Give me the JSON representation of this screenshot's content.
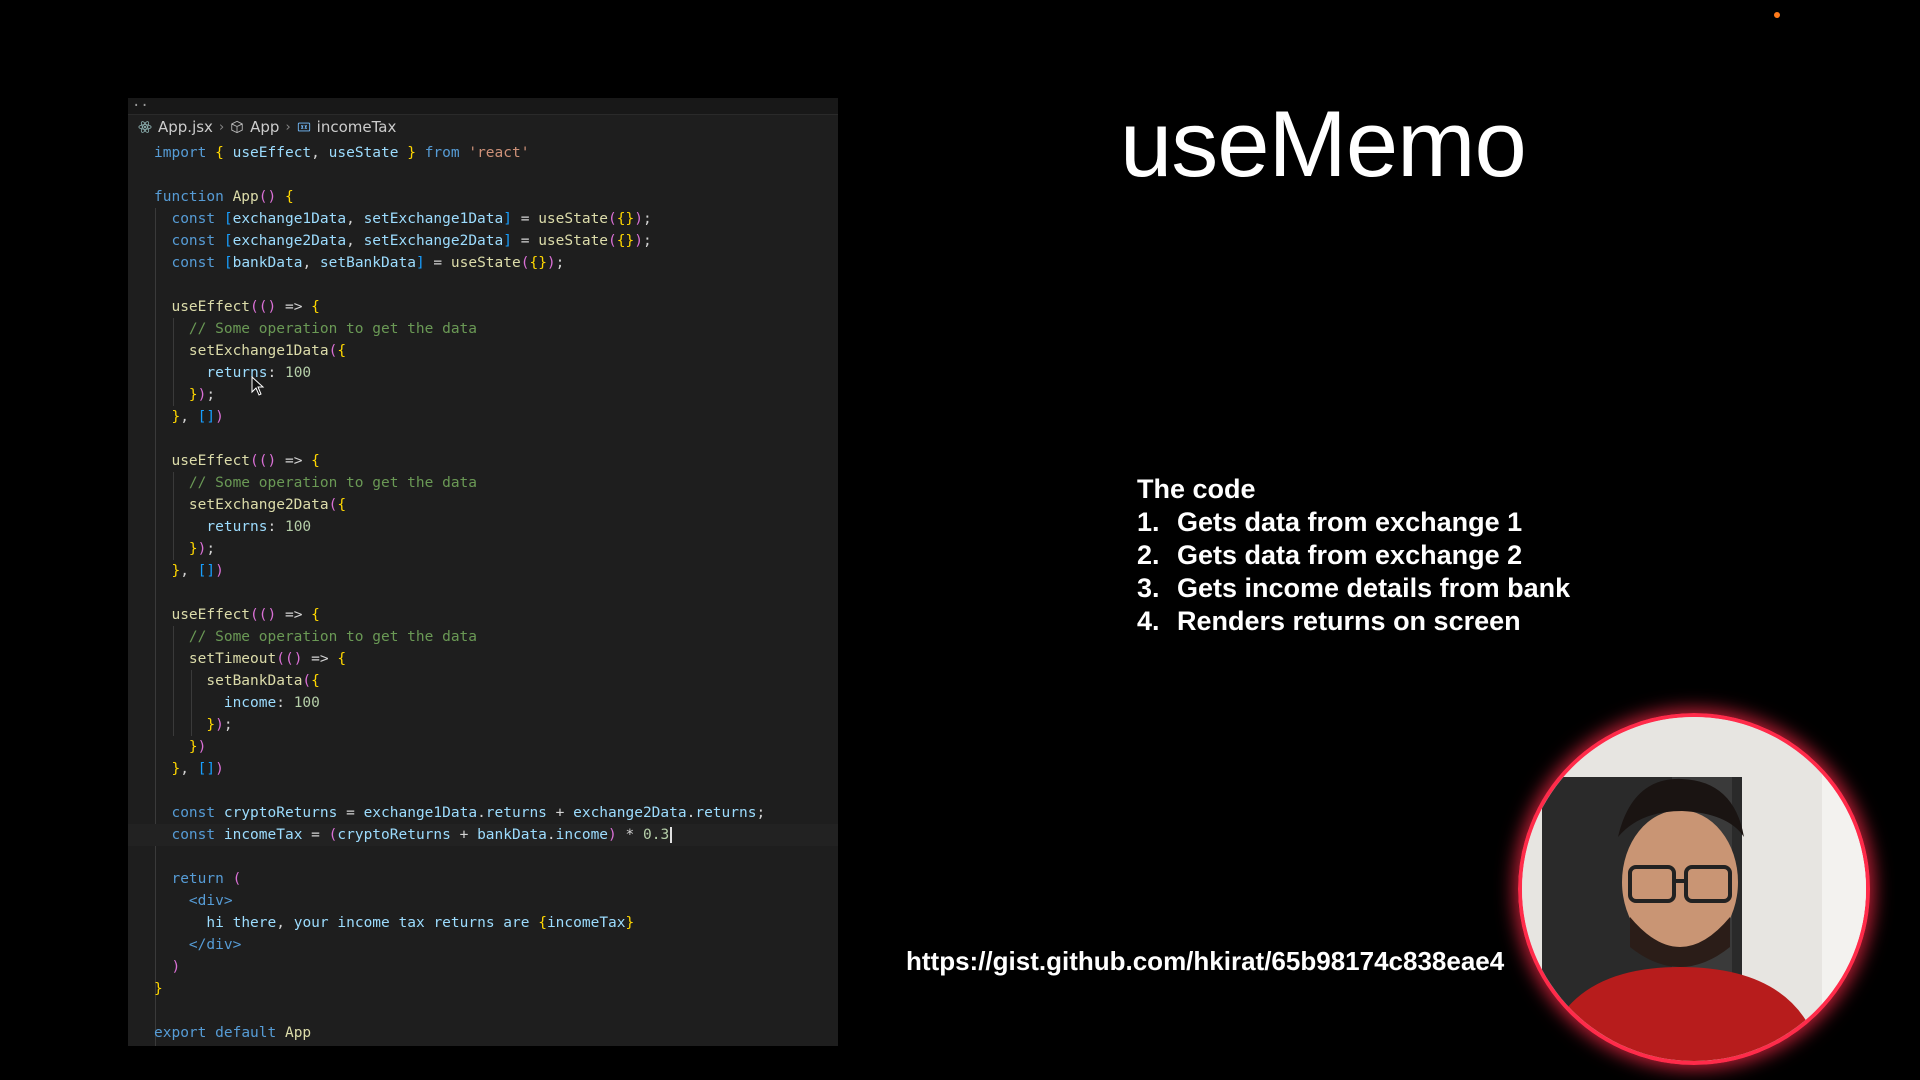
{
  "editor": {
    "tab_overflow": "..",
    "breadcrumb": {
      "file": "App.jsx",
      "component": "App",
      "symbol": "incomeTax"
    },
    "code_lines": [
      "import { useEffect, useState } from 'react'",
      "",
      "function App() {",
      "  const [exchange1Data, setExchange1Data] = useState({});",
      "  const [exchange2Data, setExchange2Data] = useState({});",
      "  const [bankData, setBankData] = useState({});",
      "",
      "  useEffect(() => {",
      "    // Some operation to get the data",
      "    setExchange1Data({",
      "      returns: 100",
      "    });",
      "  }, [])",
      "",
      "  useEffect(() => {",
      "    // Some operation to get the data",
      "    setExchange2Data({",
      "      returns: 100",
      "    });",
      "  }, [])",
      "",
      "  useEffect(() => {",
      "    // Some operation to get the data",
      "    setTimeout(() => {",
      "      setBankData({",
      "        income: 100",
      "      });",
      "    })",
      "  }, [])",
      "",
      "  const cryptoReturns = exchange1Data.returns + exchange2Data.returns;",
      "  const incomeTax = (cryptoReturns + bankData.income) * 0.3",
      "",
      "  return (",
      "    <div>",
      "      hi there, your income tax returns are {incomeTax}",
      "    </div>",
      "  )",
      "}",
      "",
      "export default App"
    ]
  },
  "slide": {
    "title": "useMemo",
    "description_heading": "The code",
    "steps": [
      {
        "num": "1.",
        "text": "Gets data from exchange 1"
      },
      {
        "num": "2.",
        "text": "Gets data from exchange 2"
      },
      {
        "num": "3.",
        "text": "Gets income details from bank"
      },
      {
        "num": "4.",
        "text": "Renders returns on screen"
      }
    ],
    "link": "https://gist.github.com/hkirat/65b98174c838eae4"
  },
  "colors": {
    "webcam_ring": "#ff2b4a",
    "recording_dot": "#ff7a1a"
  }
}
